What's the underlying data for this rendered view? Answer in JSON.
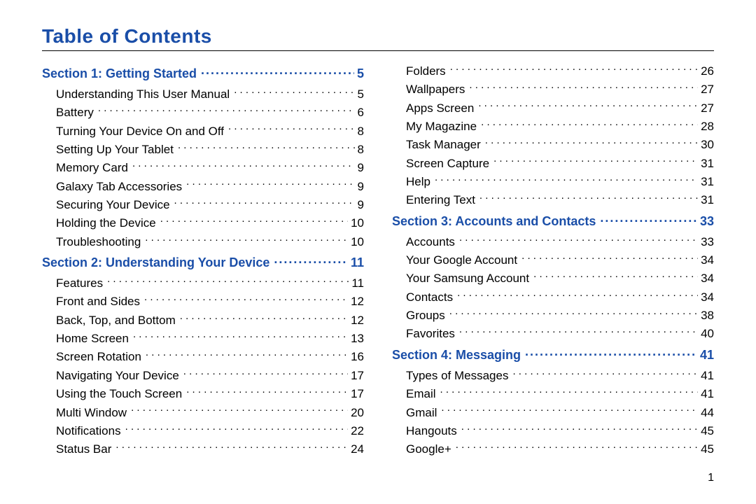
{
  "title": "Table of Contents",
  "page_number": "1",
  "columns": [
    [
      {
        "type": "section",
        "label": "Section 1:  Getting Started",
        "page": "5"
      },
      {
        "type": "entry",
        "label": "Understanding This User Manual",
        "page": "5"
      },
      {
        "type": "entry",
        "label": "Battery",
        "page": "6"
      },
      {
        "type": "entry",
        "label": "Turning Your Device On and Off",
        "page": "8"
      },
      {
        "type": "entry",
        "label": "Setting Up Your Tablet",
        "page": "8"
      },
      {
        "type": "entry",
        "label": "Memory Card",
        "page": "9"
      },
      {
        "type": "entry",
        "label": "Galaxy Tab Accessories",
        "page": "9"
      },
      {
        "type": "entry",
        "label": "Securing Your Device",
        "page": "9"
      },
      {
        "type": "entry",
        "label": "Holding the Device",
        "page": "10"
      },
      {
        "type": "entry",
        "label": "Troubleshooting",
        "page": "10"
      },
      {
        "type": "section",
        "label": "Section 2:  Understanding Your Device",
        "page": "11"
      },
      {
        "type": "entry",
        "label": "Features",
        "page": "11"
      },
      {
        "type": "entry",
        "label": "Front and Sides",
        "page": "12"
      },
      {
        "type": "entry",
        "label": "Back, Top, and Bottom",
        "page": "12"
      },
      {
        "type": "entry",
        "label": "Home Screen",
        "page": "13"
      },
      {
        "type": "entry",
        "label": "Screen Rotation",
        "page": "16"
      },
      {
        "type": "entry",
        "label": "Navigating Your Device",
        "page": "17"
      },
      {
        "type": "entry",
        "label": "Using the Touch Screen",
        "page": "17"
      },
      {
        "type": "entry",
        "label": "Multi Window",
        "page": "20"
      },
      {
        "type": "entry",
        "label": "Notifications",
        "page": "22"
      },
      {
        "type": "entry",
        "label": "Status Bar",
        "page": "24"
      }
    ],
    [
      {
        "type": "entry",
        "label": "Folders",
        "page": "26"
      },
      {
        "type": "entry",
        "label": "Wallpapers",
        "page": "27"
      },
      {
        "type": "entry",
        "label": "Apps Screen",
        "page": "27"
      },
      {
        "type": "entry",
        "label": "My Magazine",
        "page": "28"
      },
      {
        "type": "entry",
        "label": "Task Manager",
        "page": "30"
      },
      {
        "type": "entry",
        "label": "Screen Capture",
        "page": "31"
      },
      {
        "type": "entry",
        "label": "Help",
        "page": "31"
      },
      {
        "type": "entry",
        "label": "Entering Text",
        "page": "31"
      },
      {
        "type": "section",
        "label": "Section 3:  Accounts and Contacts",
        "page": "33"
      },
      {
        "type": "entry",
        "label": "Accounts",
        "page": "33"
      },
      {
        "type": "entry",
        "label": "Your Google Account",
        "page": "34"
      },
      {
        "type": "entry",
        "label": "Your Samsung Account",
        "page": "34"
      },
      {
        "type": "entry",
        "label": "Contacts",
        "page": "34"
      },
      {
        "type": "entry",
        "label": "Groups",
        "page": "38"
      },
      {
        "type": "entry",
        "label": "Favorites",
        "page": "40"
      },
      {
        "type": "section",
        "label": "Section 4:  Messaging",
        "page": "41"
      },
      {
        "type": "entry",
        "label": "Types of Messages",
        "page": "41"
      },
      {
        "type": "entry",
        "label": "Email",
        "page": "41"
      },
      {
        "type": "entry",
        "label": "Gmail",
        "page": "44"
      },
      {
        "type": "entry",
        "label": "Hangouts",
        "page": "45"
      },
      {
        "type": "entry",
        "label": "Google+",
        "page": "45"
      }
    ]
  ]
}
